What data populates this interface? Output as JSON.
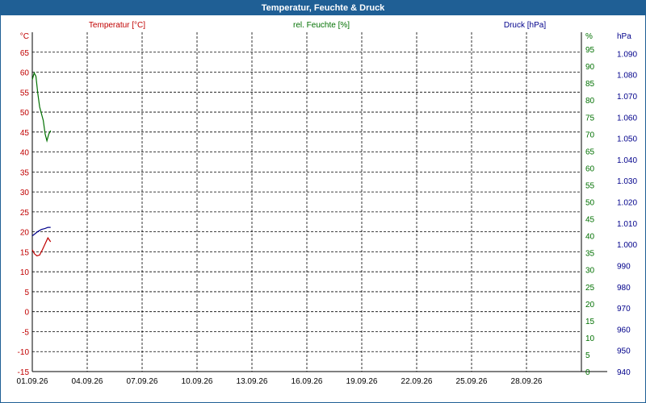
{
  "window": {
    "title": "Temperatur, Feuchte & Druck"
  },
  "chart_data": {
    "type": "line",
    "title": "Temperatur, Feuchte & Druck",
    "grid": true,
    "x": {
      "ticks": [
        "01.09.26",
        "04.09.26",
        "07.09.26",
        "10.09.26",
        "13.09.26",
        "16.09.26",
        "19.09.26",
        "22.09.26",
        "25.09.26",
        "28.09.26"
      ],
      "range_days": [
        0,
        30
      ]
    },
    "axes": {
      "left": {
        "label": "Temperatur [°C]",
        "unit": "°C",
        "range": [
          -15,
          70
        ],
        "ticks": [
          65,
          60,
          55,
          50,
          45,
          40,
          35,
          30,
          25,
          20,
          15,
          10,
          5,
          0,
          -5,
          -10,
          -15
        ],
        "color": "#c00000"
      },
      "right1": {
        "label": "rel. Feuchte [%]",
        "unit": "%",
        "range": [
          0,
          100
        ],
        "ticks": [
          95,
          90,
          85,
          80,
          75,
          70,
          65,
          60,
          55,
          50,
          45,
          40,
          35,
          30,
          25,
          20,
          15,
          10,
          5,
          0
        ],
        "color": "#007000"
      },
      "right2": {
        "label": "Druck [hPa]",
        "unit": "hPa",
        "range": [
          940,
          1100
        ],
        "ticks": [
          "1.090",
          "1.080",
          "1.070",
          "1.060",
          "1.050",
          "1.040",
          "1.030",
          "1.020",
          "1.010",
          "1.000",
          "990",
          "980",
          "970",
          "960",
          "950",
          "940"
        ],
        "color": "#00008b"
      }
    },
    "series": [
      {
        "name": "Temperatur [°C]",
        "axis": "left",
        "color": "#c00000",
        "points": [
          [
            0.0,
            15.5
          ],
          [
            0.12,
            14.5
          ],
          [
            0.25,
            14.0
          ],
          [
            0.4,
            14.2
          ],
          [
            0.55,
            15.5
          ],
          [
            0.7,
            17.0
          ],
          [
            0.85,
            18.5
          ],
          [
            1.0,
            17.5
          ]
        ]
      },
      {
        "name": "rel. Feuchte [%]",
        "axis": "right1",
        "color": "#007000",
        "points": [
          [
            0.0,
            86
          ],
          [
            0.1,
            88
          ],
          [
            0.2,
            87
          ],
          [
            0.3,
            82
          ],
          [
            0.4,
            78
          ],
          [
            0.5,
            76
          ],
          [
            0.6,
            74
          ],
          [
            0.7,
            70
          ],
          [
            0.8,
            68
          ],
          [
            0.9,
            70
          ],
          [
            1.0,
            71
          ]
        ]
      },
      {
        "name": "Druck [hPa]",
        "axis": "right2",
        "color": "#00008b",
        "points": [
          [
            0.0,
            1004
          ],
          [
            0.15,
            1005
          ],
          [
            0.3,
            1006
          ],
          [
            0.5,
            1007
          ],
          [
            0.7,
            1007.5
          ],
          [
            0.85,
            1008
          ],
          [
            1.0,
            1008
          ]
        ]
      }
    ]
  }
}
